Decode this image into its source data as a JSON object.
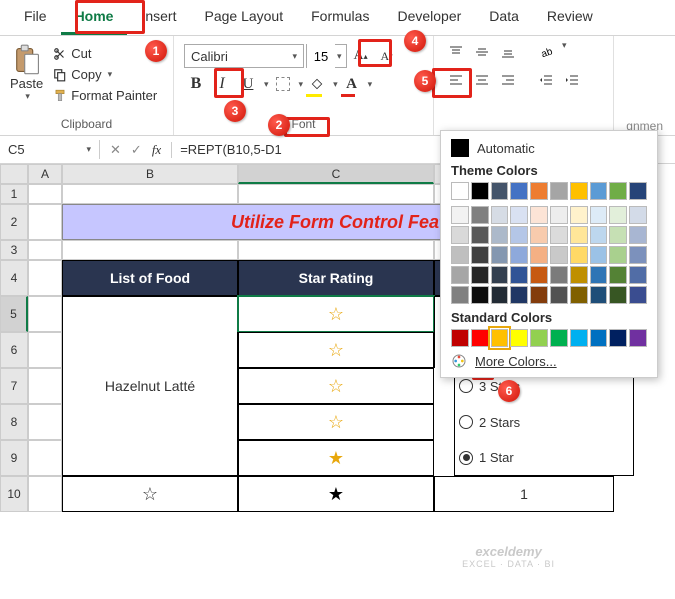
{
  "tabs": [
    "File",
    "Home",
    "Insert",
    "Page Layout",
    "Formulas",
    "Developer",
    "Data",
    "Review"
  ],
  "active_tab": "Home",
  "clipboard": {
    "paste_label": "Paste",
    "cut_label": "Cut",
    "copy_label": "Copy",
    "format_painter_label": "Format Painter",
    "group_label": "Clipboard"
  },
  "font": {
    "name": "Calibri",
    "size": "15",
    "bold": "B",
    "italic": "I",
    "underline": "U",
    "grow": "A",
    "shrink": "A",
    "group_label": "Font"
  },
  "alignment": {
    "group_label": "Alignment"
  },
  "namebox": "C5",
  "formula": "=REPT(B10,5-D1",
  "sheet": {
    "title_text": "Utilize Form Control Feat",
    "col_b_header": "List of Food",
    "col_c_header": "Star Rating",
    "b_value": "Hazelnut Latté",
    "star_outline_b10": "☆",
    "star_filled_c10": "★",
    "d10_value": "1",
    "radio_3": "3 Stars",
    "radio_2": "2 Stars",
    "radio_1": "1 Star"
  },
  "popup": {
    "automatic_label": "Automatic",
    "theme_label": "Theme Colors",
    "standard_label": "Standard Colors",
    "more_label": "More Colors...",
    "theme_row0": [
      "#ffffff",
      "#000000",
      "#44546a",
      "#4472c4",
      "#ed7d31",
      "#a5a5a5",
      "#ffc000",
      "#5b9bd5",
      "#70ad47",
      "#264478"
    ],
    "theme_shades": [
      [
        "#f2f2f2",
        "#7f7f7f",
        "#d6dce5",
        "#d9e1f2",
        "#fce4d6",
        "#ededed",
        "#fff2cc",
        "#ddebf7",
        "#e2efda",
        "#d3dbe8"
      ],
      [
        "#d9d9d9",
        "#595959",
        "#acb9ca",
        "#b4c6e7",
        "#f8cbad",
        "#dbdbdb",
        "#ffe699",
        "#bdd7ee",
        "#c6e0b4",
        "#a8b6d2"
      ],
      [
        "#bfbfbf",
        "#404040",
        "#8497b0",
        "#8ea9db",
        "#f4b084",
        "#c9c9c9",
        "#ffd966",
        "#9bc2e6",
        "#a9d08e",
        "#7c91bc"
      ],
      [
        "#a6a6a6",
        "#262626",
        "#333f4f",
        "#305496",
        "#c65911",
        "#7b7b7b",
        "#bf8f00",
        "#2f75b5",
        "#548235",
        "#516da6"
      ],
      [
        "#808080",
        "#0d0d0d",
        "#222b35",
        "#203764",
        "#833c0c",
        "#525252",
        "#806000",
        "#1f4e78",
        "#375623",
        "#3a4d90"
      ]
    ],
    "standard_row": [
      "#c00000",
      "#ff0000",
      "#ffc000",
      "#ffff00",
      "#92d050",
      "#00b050",
      "#00b0f0",
      "#0070c0",
      "#002060",
      "#7030a0"
    ],
    "selected_standard_idx": 2
  },
  "callouts": {
    "1": "1",
    "2": "2",
    "3": "3",
    "4": "4",
    "5": "5",
    "6": "6"
  },
  "watermark": {
    "brand": "exceldemy",
    "tag": "EXCEL · DATA · BI"
  }
}
